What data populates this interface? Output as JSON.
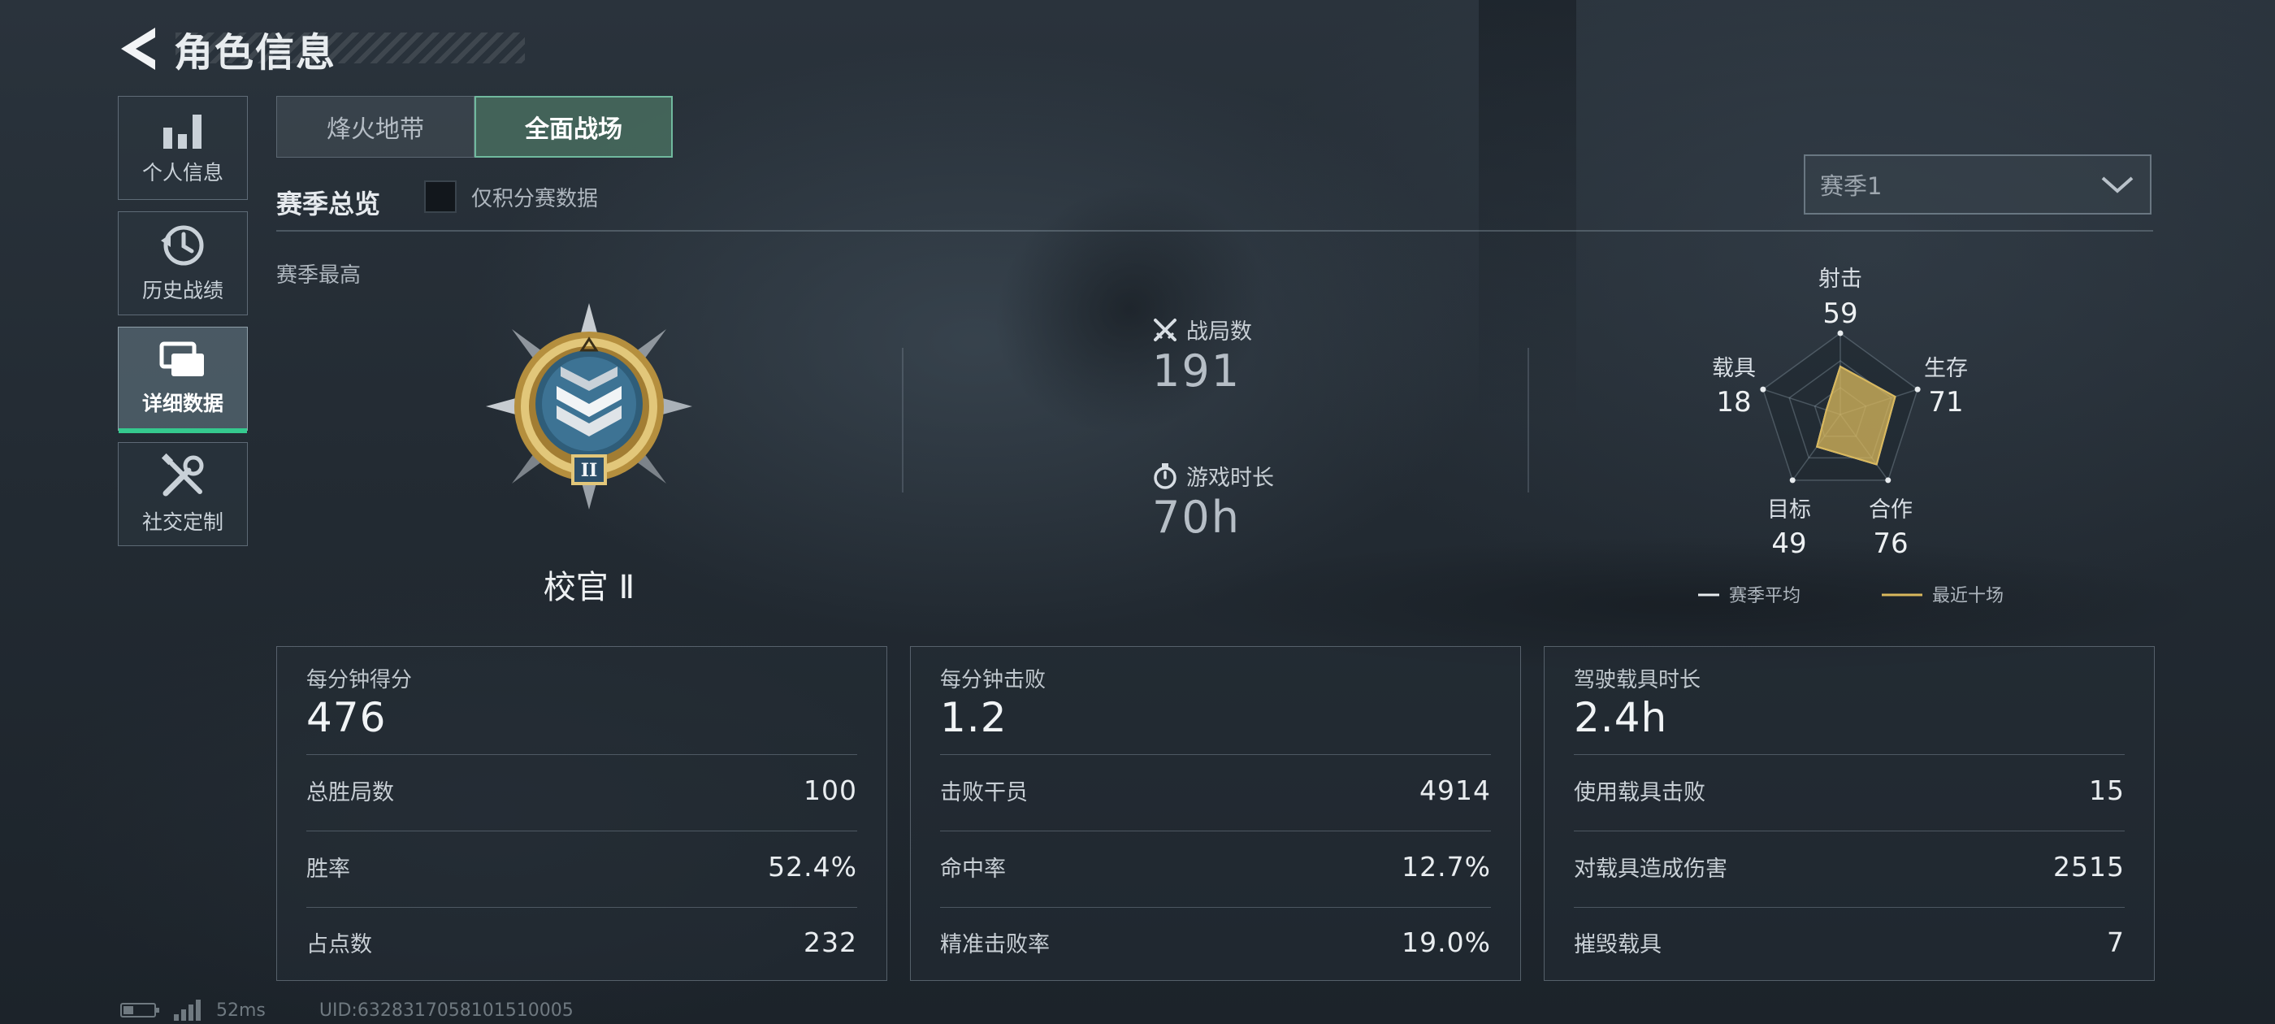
{
  "header": {
    "title": "角色信息",
    "back_icon": "back-arrow-icon"
  },
  "sidebar": {
    "items": [
      {
        "label": "个人信息",
        "icon": "bar-chart-icon",
        "active": false
      },
      {
        "label": "历史战绩",
        "icon": "history-clock-icon",
        "active": false
      },
      {
        "label": "详细数据",
        "icon": "cards-stack-icon",
        "active": true
      },
      {
        "label": "社交定制",
        "icon": "tools-icon",
        "active": false
      }
    ]
  },
  "tabs": [
    {
      "label": "烽火地带",
      "active": false
    },
    {
      "label": "全面战场",
      "active": true
    }
  ],
  "overview": {
    "title": "赛季总览",
    "checkbox_label": "仅积分赛数据",
    "checkbox_checked": false,
    "season_select": "赛季1",
    "season_best_label": "赛季最高"
  },
  "rank": {
    "name": "校官 Ⅱ",
    "badge_numeral": "II"
  },
  "stats": {
    "matches": {
      "label": "战局数",
      "value": "191",
      "icon": "crossed-swords-icon"
    },
    "playtime": {
      "label": "游戏时长",
      "value": "70h",
      "icon": "stopwatch-icon"
    }
  },
  "radar": {
    "axes": [
      {
        "label": "射击",
        "value": "59"
      },
      {
        "label": "生存",
        "value": "71"
      },
      {
        "label": "合作",
        "value": "76"
      },
      {
        "label": "目标",
        "value": "49"
      },
      {
        "label": "载具",
        "value": "18"
      }
    ],
    "legend": [
      {
        "label": "赛季平均",
        "color": "#e8ecef"
      },
      {
        "label": "最近十场",
        "color": "#d9b85c"
      }
    ]
  },
  "cards": [
    {
      "title": "每分钟得分",
      "value": "476",
      "rows": [
        {
          "label": "总胜局数",
          "value": "100"
        },
        {
          "label": "胜率",
          "value": "52.4%"
        },
        {
          "label": "占点数",
          "value": "232"
        }
      ]
    },
    {
      "title": "每分钟击败",
      "value": "1.2",
      "rows": [
        {
          "label": "击败干员",
          "value": "4914"
        },
        {
          "label": "命中率",
          "value": "12.7%"
        },
        {
          "label": "精准击败率",
          "value": "19.0%"
        }
      ]
    },
    {
      "title": "驾驶载具时长",
      "value": "2.4h",
      "rows": [
        {
          "label": "使用载具击败",
          "value": "15"
        },
        {
          "label": "对载具造成伤害",
          "value": "2515"
        },
        {
          "label": "摧毁载具",
          "value": "7"
        }
      ]
    }
  ],
  "footer": {
    "ping": "52ms",
    "uid": "UID:6328317058101510005"
  },
  "colors": {
    "accent_green": "#35c98e",
    "radar_fill": "#d9b85c"
  }
}
